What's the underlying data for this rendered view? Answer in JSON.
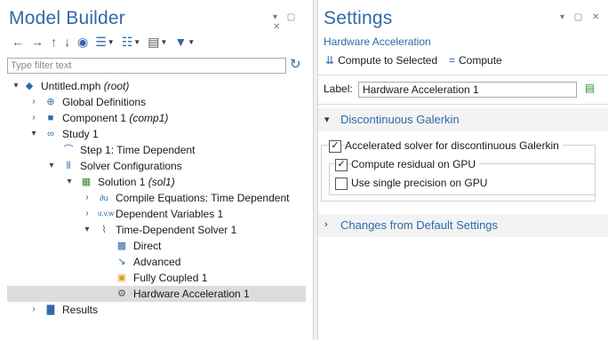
{
  "model_builder": {
    "title": "Model Builder",
    "filter_placeholder": "Type filter text",
    "tree": [
      {
        "label": "Untitled.mph",
        "suffix": "(root)",
        "arrow": "▾"
      },
      {
        "label": "Global Definitions",
        "suffix": "",
        "arrow": "›"
      },
      {
        "label": "Component 1",
        "suffix": "(comp1)",
        "arrow": "›"
      },
      {
        "label": "Study 1",
        "suffix": "",
        "arrow": "▾"
      },
      {
        "label": "Step 1: Time Dependent",
        "suffix": "",
        "arrow": ""
      },
      {
        "label": "Solver Configurations",
        "suffix": "",
        "arrow": "▾"
      },
      {
        "label": "Solution 1",
        "suffix": "(sol1)",
        "arrow": "▾"
      },
      {
        "label": "Compile Equations: Time Dependent",
        "suffix": "",
        "arrow": "›"
      },
      {
        "label": "Dependent Variables 1",
        "suffix": "",
        "arrow": "›"
      },
      {
        "label": "Time-Dependent Solver 1",
        "suffix": "",
        "arrow": "▾"
      },
      {
        "label": "Direct",
        "suffix": "",
        "arrow": ""
      },
      {
        "label": "Advanced",
        "suffix": "",
        "arrow": ""
      },
      {
        "label": "Fully Coupled 1",
        "suffix": "",
        "arrow": ""
      },
      {
        "label": "Hardware Acceleration 1",
        "suffix": "",
        "arrow": ""
      },
      {
        "label": "Results",
        "suffix": "",
        "arrow": "›"
      }
    ]
  },
  "settings": {
    "title": "Settings",
    "subtitle": "Hardware Acceleration",
    "compute_selected": "Compute to Selected",
    "compute": "Compute",
    "label_caption": "Label:",
    "label_value": "Hardware Acceleration 1",
    "section1": "Discontinuous Galerkin",
    "section2": "Changes from Default Settings",
    "cb_accelerated": "Accelerated solver for discontinuous Galerkin",
    "cb_residual": "Compute residual on GPU",
    "cb_single": "Use single precision on GPU",
    "cb_accelerated_checked": true,
    "cb_residual_checked": true,
    "cb_single_checked": false
  },
  "colors": {
    "accent": "#2e6aa8",
    "selected_row": "#dcdcdc"
  }
}
